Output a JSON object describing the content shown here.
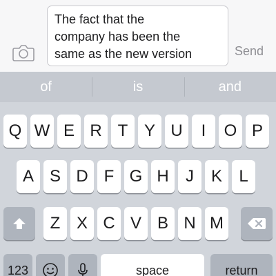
{
  "compose": {
    "message_lines": [
      "The fact that the",
      "company has been the",
      "same as the new version"
    ],
    "send_label": "Send",
    "camera_icon": "camera-icon"
  },
  "predictions": [
    "of",
    "is",
    "and"
  ],
  "keyboard": {
    "row1": [
      "Q",
      "W",
      "E",
      "R",
      "T",
      "Y",
      "U",
      "I",
      "O",
      "P"
    ],
    "row2": [
      "A",
      "S",
      "D",
      "F",
      "G",
      "H",
      "J",
      "K",
      "L"
    ],
    "row3": [
      "Z",
      "X",
      "C",
      "V",
      "B",
      "N",
      "M"
    ],
    "numbers_label": "123",
    "space_label": "space",
    "return_label": "return",
    "shift_icon": "shift-arrow-icon",
    "delete_icon": "backspace-icon",
    "emoji_icon": "emoji-icon",
    "dictation_icon": "microphone-icon"
  },
  "colors": {
    "send_disabled": "#8e8e93",
    "keyboard_bg": "#d1d5db",
    "key_face": "#ffffff",
    "function_key": "#aeb4bd"
  }
}
